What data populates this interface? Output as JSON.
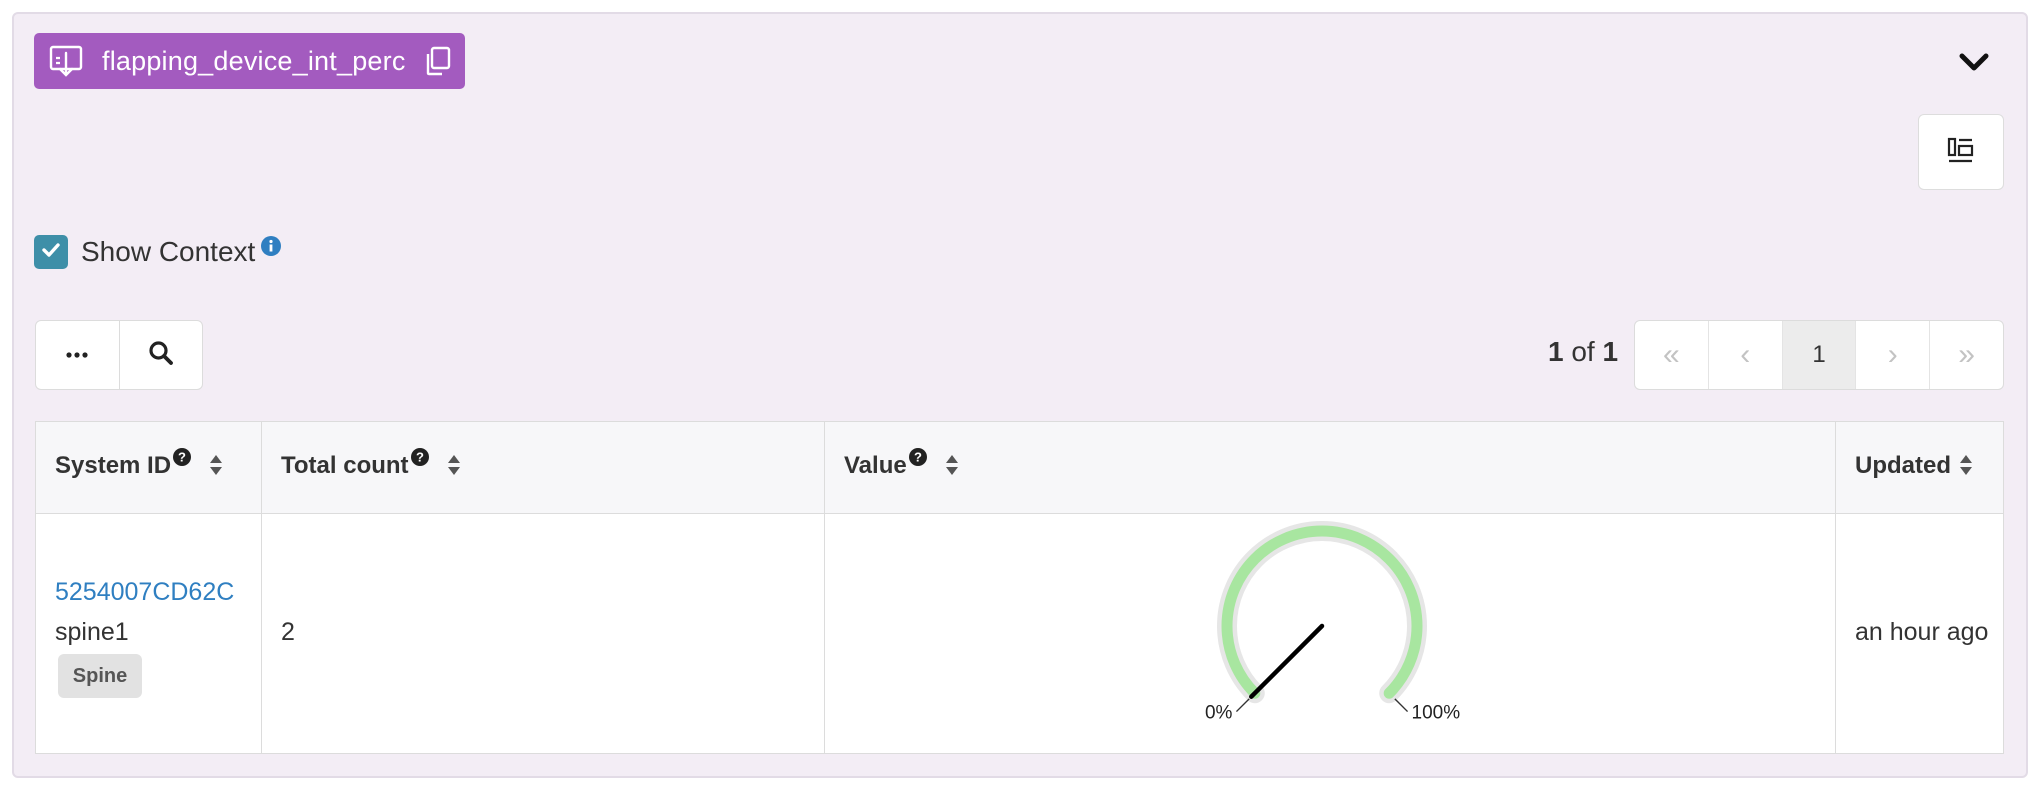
{
  "probe": {
    "name": "flapping_device_int_perc"
  },
  "show_context": {
    "label": "Show Context",
    "checked": true
  },
  "pagination": {
    "current": "1",
    "of_word": "of",
    "total": "1",
    "page_button": "1"
  },
  "table": {
    "columns": [
      {
        "label": "System ID"
      },
      {
        "label": "Total count"
      },
      {
        "label": "Value"
      },
      {
        "label": "Updated"
      }
    ],
    "rows": [
      {
        "system_id": "5254007CD62C",
        "hostname": "spine1",
        "role": "Spine",
        "total_count": "2",
        "value": {
          "min_label": "0%",
          "max_label": "100%",
          "percent": 0
        },
        "updated": "an hour ago"
      }
    ]
  },
  "colors": {
    "probe_tag": "#a35bbf",
    "checkbox": "#3e8fa8",
    "link": "#2f7fc1",
    "gauge_arc": "#a8e6a0"
  },
  "icons": [
    "probe-output-icon",
    "copy-icon",
    "chevron-down-icon",
    "layout-icon",
    "check-icon",
    "info-icon",
    "ellipsis-icon",
    "search-icon",
    "help-icon",
    "sort-icon"
  ]
}
